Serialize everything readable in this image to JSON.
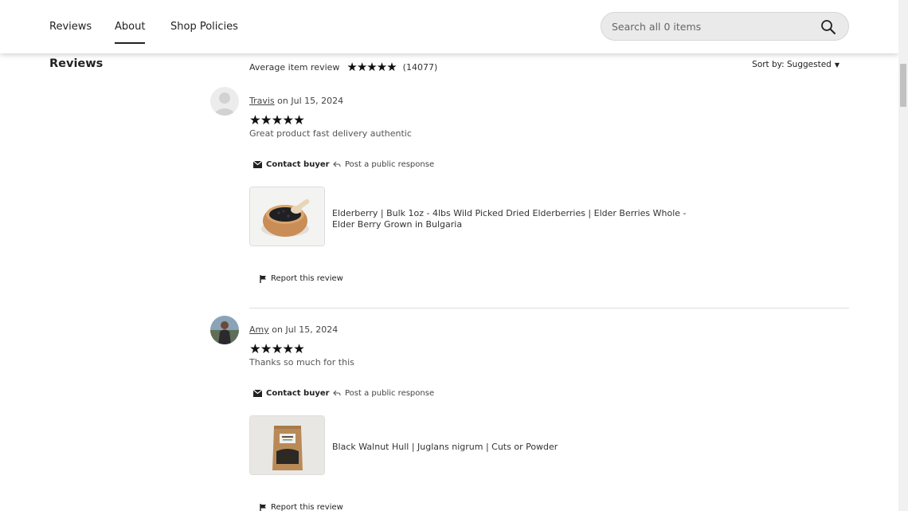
{
  "nav": {
    "items": [
      "Reviews",
      "About",
      "Shop Policies"
    ],
    "search_placeholder": "Search all 0 items",
    "search_icon": "search-icon"
  },
  "reviews_section": {
    "title": "Reviews",
    "average_label": "Average item review",
    "average_rating": 5,
    "count_text": "(14077)",
    "sort_label": "Sort by: Suggested"
  },
  "reviews": [
    {
      "reviewer": "Travis",
      "date_text": "on Jul 15, 2024",
      "rating": 5,
      "text": "Great product fast delivery authentic",
      "contact_label": "Contact buyer",
      "respond_label": "Post a public response",
      "item_title": "Elderberry | Bulk 1oz - 4lbs Wild Picked Dried Elderberries | Elder Berries Whole - Elder Berry Grown in Bulgaria",
      "report_label": "Report this review"
    },
    {
      "reviewer": "Amy",
      "date_text": "on Jul 15, 2024",
      "rating": 5,
      "text": "Thanks so much for this",
      "contact_label": "Contact buyer",
      "respond_label": "Post a public response",
      "item_title": "Black Walnut Hull | Juglans nigrum | Cuts or Powder",
      "report_label": "Report this review"
    }
  ]
}
